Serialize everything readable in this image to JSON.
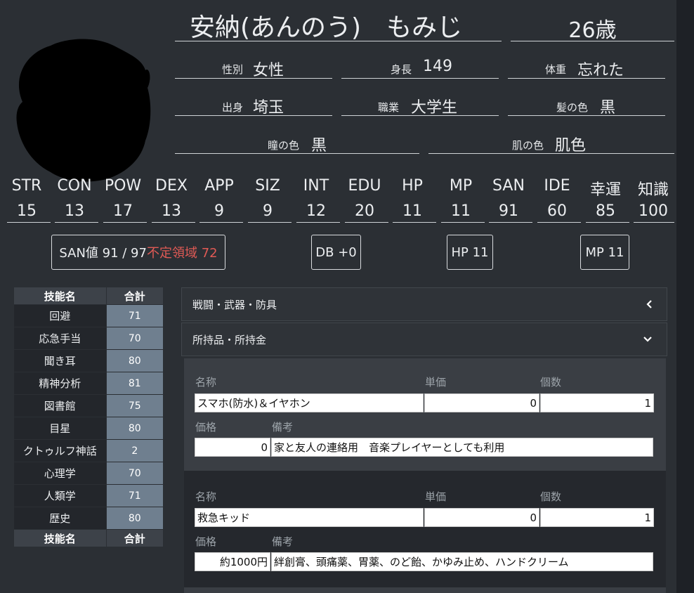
{
  "profile": {
    "name": "安納(あんのう)　もみじ",
    "age": "26歳",
    "fields": [
      {
        "label": "性別",
        "value": "女性"
      },
      {
        "label": "身長",
        "value": "149"
      },
      {
        "label": "体重",
        "value": "忘れた"
      },
      {
        "label": "出身",
        "value": "埼玉"
      },
      {
        "label": "職業",
        "value": "大学生"
      },
      {
        "label": "髪の色",
        "value": "黒"
      },
      {
        "label": "瞳の色",
        "value": "黒"
      },
      {
        "label": "肌の色",
        "value": "肌色"
      }
    ]
  },
  "stats": [
    {
      "name": "STR",
      "value": "15"
    },
    {
      "name": "CON",
      "value": "13"
    },
    {
      "name": "POW",
      "value": "17"
    },
    {
      "name": "DEX",
      "value": "13"
    },
    {
      "name": "APP",
      "value": "9"
    },
    {
      "name": "SIZ",
      "value": "9"
    },
    {
      "name": "INT",
      "value": "12"
    },
    {
      "name": "EDU",
      "value": "20"
    },
    {
      "name": "HP",
      "value": "11"
    },
    {
      "name": "MP",
      "value": "11"
    },
    {
      "name": "SAN",
      "value": "91"
    },
    {
      "name": "IDE",
      "value": "60"
    },
    {
      "name": "幸運",
      "value": "85"
    },
    {
      "name": "知識",
      "value": "100"
    }
  ],
  "badges": {
    "san": "SAN値 91 / 97",
    "san_unstable": "不定領域 72",
    "db": "DB +0",
    "hp": "HP 11",
    "mp": "MP 11"
  },
  "skills": {
    "header_name": "技能名",
    "header_total": "合計",
    "rows": [
      {
        "name": "回避",
        "total": "71"
      },
      {
        "name": "応急手当",
        "total": "70"
      },
      {
        "name": "聞き耳",
        "total": "80"
      },
      {
        "name": "精神分析",
        "total": "81"
      },
      {
        "name": "図書館",
        "total": "75"
      },
      {
        "name": "目星",
        "total": "80"
      },
      {
        "name": "クトゥルフ神話",
        "total": "2"
      },
      {
        "name": "心理学",
        "total": "70"
      },
      {
        "name": "人類学",
        "total": "71"
      },
      {
        "name": "歴史",
        "total": "80"
      }
    ]
  },
  "panels": {
    "combat": "戦闘・武器・防具",
    "items": "所持品・所持金"
  },
  "item_labels": {
    "name": "名称",
    "unit_price": "単価",
    "count": "個数",
    "price": "価格",
    "note": "備考"
  },
  "items": [
    {
      "name": "スマホ(防水)＆イヤホン",
      "unit_price": "0",
      "count": "1",
      "price": "0",
      "note": "家と友人の連絡用　音楽プレイヤーとしても利用"
    },
    {
      "name": "救急キッド",
      "unit_price": "0",
      "count": "1",
      "price": "約1000円",
      "note": "絆創膏、頭痛薬、胃薬、のど飴、かゆみ止め、ハンドクリーム"
    }
  ],
  "icons": {
    "combat_chevron": "chevron-left-icon",
    "items_chevron": "chevron-down-icon"
  }
}
